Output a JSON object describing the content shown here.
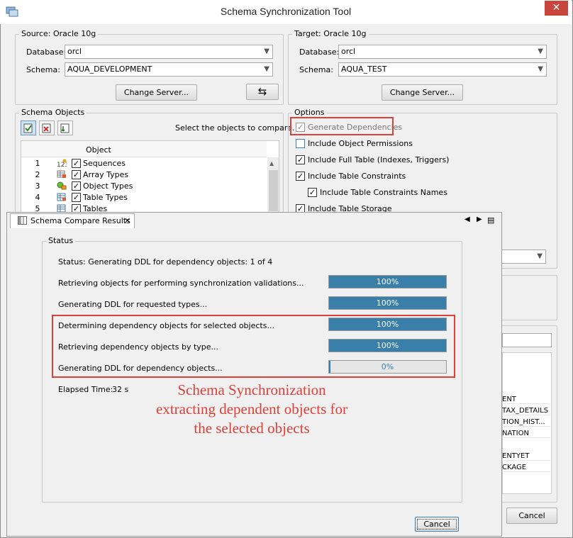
{
  "window": {
    "title": "Schema Synchronization Tool",
    "close": "✕"
  },
  "source": {
    "group_label": "Source: Oracle 10g",
    "database_label": "Database:",
    "database_value": "orcl",
    "schema_label": "Schema:",
    "schema_value": "AQUA_DEVELOPMENT",
    "change_server": "Change Server...",
    "swap": "⇆"
  },
  "target": {
    "group_label": "Target: Oracle 10g",
    "database_label": "Database:",
    "database_value": "orcl",
    "schema_label": "Schema:",
    "schema_value": "AQUA_TEST",
    "change_server": "Change Server..."
  },
  "schema_objects": {
    "group_label": "Schema Objects",
    "hint": "Select the objects to compare.",
    "column_object": "Object",
    "rows": [
      {
        "num": "1",
        "label": "Sequences",
        "icon": "sequence-icon"
      },
      {
        "num": "2",
        "label": "Array Types",
        "icon": "array-type-icon"
      },
      {
        "num": "3",
        "label": "Object Types",
        "icon": "object-type-icon"
      },
      {
        "num": "4",
        "label": "Table Types",
        "icon": "table-type-icon"
      },
      {
        "num": "5",
        "label": "Tables",
        "icon": "table-icon"
      }
    ]
  },
  "options": {
    "group_label": "Options",
    "items": [
      {
        "label": "Generate Dependencies",
        "checked": true
      },
      {
        "label": "Include Object Permissions",
        "checked": false
      },
      {
        "label": "Include Full Table (Indexes, Triggers)",
        "checked": true
      },
      {
        "label": "Include Table Constraints",
        "checked": true
      },
      {
        "label": "Include Table Constraints Names",
        "checked": true
      },
      {
        "label": "Include Table Storage",
        "checked": true
      }
    ]
  },
  "background_list": [
    "ENT",
    "TAX_DETAILS",
    "TION_HIST...",
    "NATION",
    "ENTYET",
    "CKAGE"
  ],
  "background_cancel": "Cancel",
  "results": {
    "tab_label": "Schema Compare Results",
    "tab_close": "✕",
    "nav": [
      "◀",
      "▶",
      "▤"
    ],
    "status_group": "Status",
    "status_text": "Status: Generating DDL for dependency objects: 1 of 4",
    "tasks": [
      {
        "label": "Retrieving objects for performing synchronization validations...",
        "progress": 100,
        "pct": "100%"
      },
      {
        "label": "Generating DDL for requested types...",
        "progress": 100,
        "pct": "100%"
      },
      {
        "label": "Determining dependency objects for selected objects...",
        "progress": 100,
        "pct": "100%"
      },
      {
        "label": "Retrieving dependency objects by type...",
        "progress": 100,
        "pct": "100%"
      },
      {
        "label": "Generating DDL for dependency objects...",
        "progress": 0,
        "pct": "0%"
      }
    ],
    "elapsed_label": "Elapsed Time:",
    "elapsed_value": "32 s",
    "cancel": "Cancel"
  },
  "annotation": {
    "line1": "Schema Synchronization",
    "line2": "extracting dependent objects for",
    "line3": "the selected objects"
  },
  "colors": {
    "accent": "#3a7faa",
    "highlight": "#d9413b",
    "close": "#c7453a"
  }
}
